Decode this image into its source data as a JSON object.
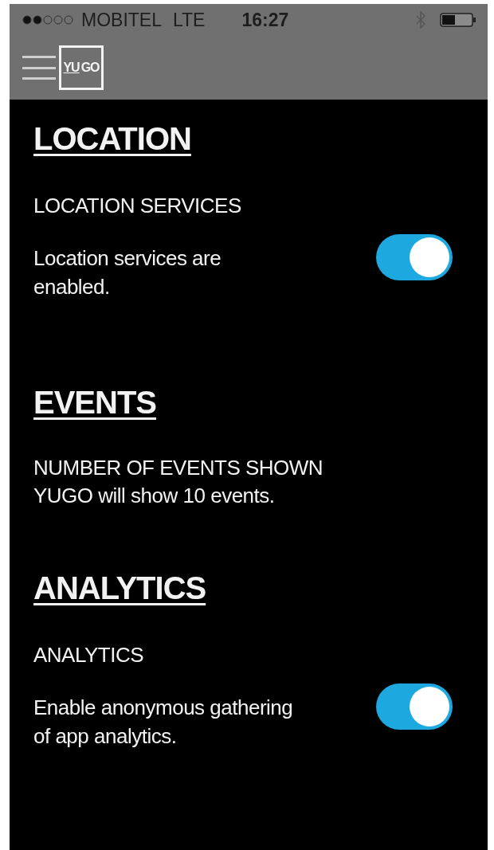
{
  "status_bar": {
    "carrier": "MOBITEL",
    "network": "LTE",
    "time": "16:27"
  },
  "header": {
    "logo": {
      "underlined": "YU",
      "rest": "GO"
    }
  },
  "sections": [
    {
      "kind": "toggle",
      "title": "LOCATION",
      "label": "LOCATION SERVICES",
      "lines": [
        "Location services are",
        "enabled."
      ],
      "on": true
    },
    {
      "kind": "info",
      "title": "EVENTS",
      "label": "NUMBER OF EVENTS SHOWN",
      "lines": [
        "YUGO will show 10 events."
      ]
    },
    {
      "kind": "toggle",
      "title": "ANALYTICS",
      "label": "ANALYTICS",
      "lines": [
        "Enable anonymous gathering",
        "of app analytics."
      ],
      "on": true
    }
  ]
}
